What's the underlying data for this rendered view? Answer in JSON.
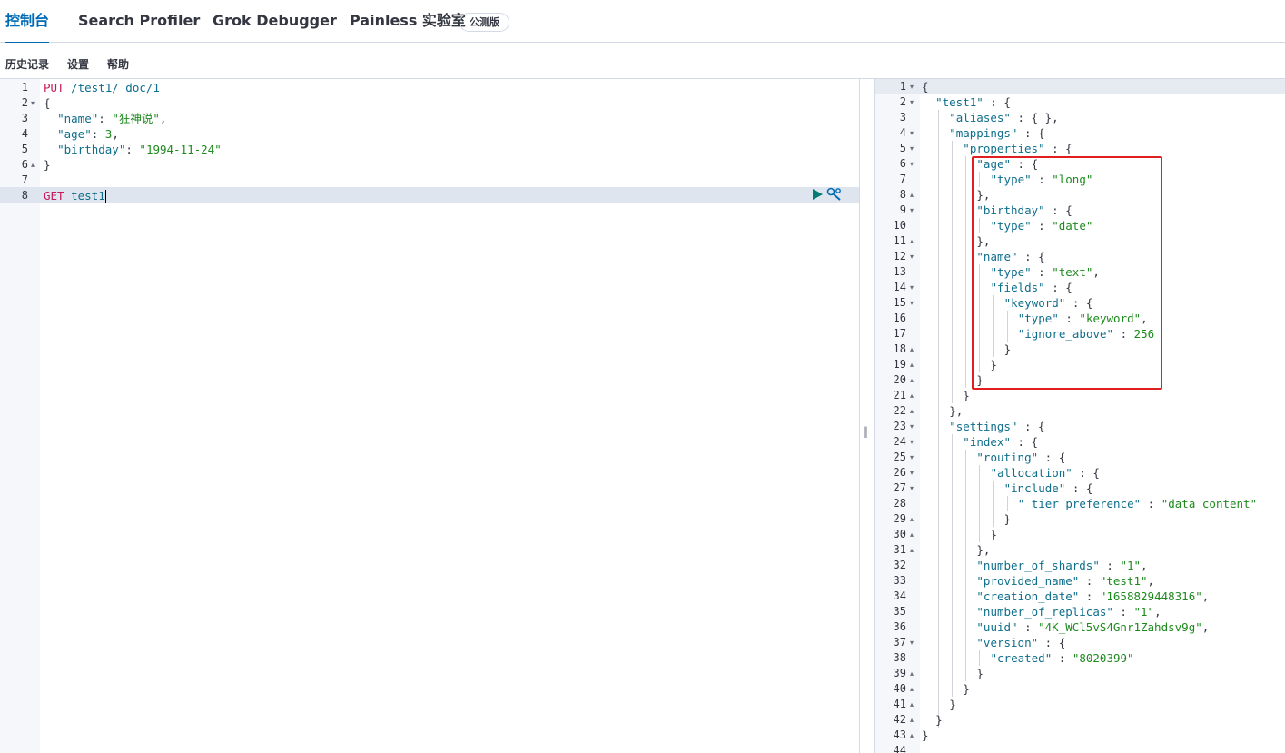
{
  "tabs": [
    {
      "label": "控制台",
      "active": true
    },
    {
      "label": "Search Profiler",
      "active": false
    },
    {
      "label": "Grok Debugger",
      "active": false
    },
    {
      "label": "Painless 实验室",
      "active": false
    }
  ],
  "beta_badge": "公测版",
  "submenu": {
    "history": "历史记录",
    "settings": "设置",
    "help": "帮助"
  },
  "colors": {
    "accent": "#006bb4",
    "highlight_box": "#e02020",
    "method": "#c5195a",
    "string": "#1e8a1e",
    "key": "#0e6e8b"
  },
  "request_editor": {
    "line_numbers": [
      "1",
      "2",
      "3",
      "4",
      "5",
      "6",
      "7",
      "8"
    ],
    "lines": [
      {
        "method": "PUT",
        "path": " /test1/_doc/1"
      },
      {
        "text": "{"
      },
      {
        "key": "\"name\"",
        "sep": ": ",
        "value": "\"狂神说\"",
        "end": ","
      },
      {
        "key": "\"age\"",
        "sep": ": ",
        "value": "3",
        "end": ","
      },
      {
        "key": "\"birthday\"",
        "sep": ": ",
        "value": "\"1994-11-24\"",
        "end": ""
      },
      {
        "text": "}"
      },
      {
        "text": ""
      },
      {
        "method": "GET",
        "path": " test1"
      }
    ],
    "run_icon": "play-icon",
    "tools_icon": "wrench-icon"
  },
  "response_editor": {
    "line_numbers": [
      "1",
      "2",
      "3",
      "4",
      "5",
      "6",
      "7",
      "8",
      "9",
      "10",
      "11",
      "12",
      "13",
      "14",
      "15",
      "16",
      "17",
      "18",
      "19",
      "20",
      "21",
      "22",
      "23",
      "24",
      "25",
      "26",
      "27",
      "28",
      "29",
      "30",
      "31",
      "32",
      "33",
      "34",
      "35",
      "36",
      "37",
      "38",
      "39",
      "40",
      "41",
      "42",
      "43",
      "44"
    ],
    "lines": [
      [
        "{"
      ],
      [
        "\"test1\"",
        " : {"
      ],
      [
        "\"aliases\"",
        " : { },"
      ],
      [
        "\"mappings\"",
        " : {"
      ],
      [
        "\"properties\"",
        " : {"
      ],
      [
        "\"age\"",
        " : {"
      ],
      [
        "\"type\"",
        " : ",
        "\"long\""
      ],
      [
        "},"
      ],
      [
        "\"birthday\"",
        " : {"
      ],
      [
        "\"type\"",
        " : ",
        "\"date\""
      ],
      [
        "},"
      ],
      [
        "\"name\"",
        " : {"
      ],
      [
        "\"type\"",
        " : ",
        "\"text\"",
        ","
      ],
      [
        "\"fields\"",
        " : {"
      ],
      [
        "\"keyword\"",
        " : {"
      ],
      [
        "\"type\"",
        " : ",
        "\"keyword\"",
        ","
      ],
      [
        "\"ignore_above\"",
        " : ",
        "256"
      ],
      [
        "}"
      ],
      [
        "}"
      ],
      [
        "}"
      ],
      [
        "}"
      ],
      [
        "},"
      ],
      [
        "\"settings\"",
        " : {"
      ],
      [
        "\"index\"",
        " : {"
      ],
      [
        "\"routing\"",
        " : {"
      ],
      [
        "\"allocation\"",
        " : {"
      ],
      [
        "\"include\"",
        " : {"
      ],
      [
        "\"_tier_preference\"",
        " : ",
        "\"data_content\""
      ],
      [
        "}"
      ],
      [
        "}"
      ],
      [
        "},"
      ],
      [
        "\"number_of_shards\"",
        " : ",
        "\"1\"",
        ","
      ],
      [
        "\"provided_name\"",
        " : ",
        "\"test1\"",
        ","
      ],
      [
        "\"creation_date\"",
        " : ",
        "\"1658829448316\"",
        ","
      ],
      [
        "\"number_of_replicas\"",
        " : ",
        "\"1\"",
        ","
      ],
      [
        "\"uuid\"",
        " : ",
        "\"4K_WCl5vS4Gnr1Zahdsv9g\"",
        ","
      ],
      [
        "\"version\"",
        " : {"
      ],
      [
        "\"created\"",
        " : ",
        "\"8020399\""
      ],
      [
        "}"
      ],
      [
        "}"
      ],
      [
        "}"
      ],
      [
        "}"
      ],
      [
        "}"
      ],
      [
        ""
      ]
    ]
  }
}
